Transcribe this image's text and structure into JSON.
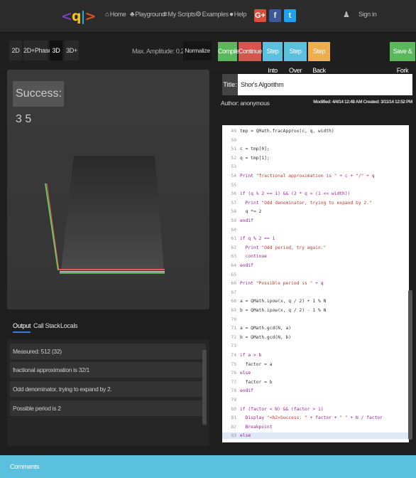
{
  "navbar": {
    "logo": {
      "left": "<",
      "q": "q",
      "bar": "|",
      "right": ">"
    },
    "items": [
      {
        "label": "Home",
        "icon": "home-icon",
        "glyph": "⌂"
      },
      {
        "label": "Playground",
        "icon": "flask-icon",
        "glyph": "♣"
      },
      {
        "label": "My Scripts",
        "icon": "list-icon",
        "glyph": "≡"
      },
      {
        "label": "Examples",
        "icon": "gear-icon",
        "glyph": "⚙",
        "caret": "▾"
      },
      {
        "label": "Help",
        "icon": "help-icon",
        "glyph": "●"
      }
    ],
    "social": [
      {
        "label": "G+",
        "icon": "google-plus-icon",
        "color": "#dd4b39"
      },
      {
        "label": "f",
        "icon": "facebook-icon",
        "color": "#3b5998"
      },
      {
        "label": "t",
        "icon": "twitter-icon",
        "color": "#1da1f2"
      }
    ],
    "user_icon": "user-icon",
    "user_glyph": "♟",
    "sign_in": "Sign in"
  },
  "view_toolbar": {
    "modes": [
      "2D",
      "2D+Phase",
      "3D",
      "3D+"
    ],
    "active_mode": "3D",
    "max_amplitude": "Max. Amplitude: 0.250000",
    "normalize": "Normalize"
  },
  "visualization": {
    "success_text": "Success: 3 5",
    "type": "3d-amplitude-surface"
  },
  "output_tabs": [
    "Output",
    "Call Stack",
    "Locals"
  ],
  "output_lines": [
    "Measured: 512 (32)",
    "fractional approximation is 32/1",
    "Odd denominator, trying to expand by 2.",
    "Possible period is 2"
  ],
  "editor_toolbar": {
    "buttons": [
      {
        "label": "Compile",
        "color": "#5cb85c"
      },
      {
        "label": "Continue",
        "color": "#d9534f"
      },
      {
        "label": "Step Into",
        "color": "#5bc0de"
      },
      {
        "label": "Step Over",
        "color": "#5bc0de"
      },
      {
        "label": "Step Back",
        "color": "#f0ad4e"
      },
      {
        "label": "Save & Fork",
        "color": "#5cb85c"
      }
    ]
  },
  "script": {
    "title_label": "Title:",
    "title_value": "Shor's Algorithm",
    "author": "Author: anonymous",
    "dates": "Modified: 4/4/14 12:48 AM   Created: 3/11/14 12:52 PM"
  },
  "code": [
    {
      "n": "49",
      "t": "tmp = QMath.fracApprox(c, q, width)",
      "k": "id"
    },
    {
      "n": "50",
      "t": "",
      "k": "id"
    },
    {
      "n": "51",
      "t": "c = tmp[0];",
      "k": "id"
    },
    {
      "n": "52",
      "t": "q = tmp[1];",
      "k": "id"
    },
    {
      "n": "53",
      "t": "",
      "k": "id"
    },
    {
      "n": "54",
      "t": "Print \"fractional approximation is \" + c + \"/\" + q",
      "k": "mix"
    },
    {
      "n": "55",
      "t": "",
      "k": "id"
    },
    {
      "n": "56",
      "t": "if (q % 2 == 1) && (2 * q < (1 << width))",
      "k": "kw"
    },
    {
      "n": "57",
      "t": "  Print \"Odd denominator, trying to expand by 2.\"",
      "k": "mix"
    },
    {
      "n": "58",
      "t": "  q *= 2",
      "k": "id"
    },
    {
      "n": "59",
      "t": "endif",
      "k": "kw"
    },
    {
      "n": "60",
      "t": "",
      "k": "id"
    },
    {
      "n": "61",
      "t": "if q % 2 == 1",
      "k": "kw"
    },
    {
      "n": "62",
      "t": "  Print \"Odd period, try again.\"",
      "k": "mix"
    },
    {
      "n": "63",
      "t": "  continue",
      "k": "kw"
    },
    {
      "n": "64",
      "t": "endif",
      "k": "kw"
    },
    {
      "n": "65",
      "t": "",
      "k": "id"
    },
    {
      "n": "66",
      "t": "Print \"Possible period is \" + q",
      "k": "mix"
    },
    {
      "n": "67",
      "t": "",
      "k": "id"
    },
    {
      "n": "68",
      "t": "a = QMath.ipow(x, q / 2) + 1 % N",
      "k": "id"
    },
    {
      "n": "69",
      "t": "b = QMath.ipow(x, q / 2) - 1 % N",
      "k": "id"
    },
    {
      "n": "70",
      "t": "",
      "k": "id"
    },
    {
      "n": "71",
      "t": "a = QMath.gcd(N, a)",
      "k": "id"
    },
    {
      "n": "72",
      "t": "b = QMath.gcd(N, b)",
      "k": "id"
    },
    {
      "n": "73",
      "t": "",
      "k": "id"
    },
    {
      "n": "74",
      "t": "if a > b",
      "k": "kw"
    },
    {
      "n": "75",
      "t": "  factor = a",
      "k": "id"
    },
    {
      "n": "76",
      "t": "else",
      "k": "kw"
    },
    {
      "n": "77",
      "t": "  factor = b",
      "k": "id"
    },
    {
      "n": "78",
      "t": "endif",
      "k": "kw"
    },
    {
      "n": "79",
      "t": "",
      "k": "id"
    },
    {
      "n": "80",
      "t": "if (factor < N) && (factor > 1)",
      "k": "kw"
    },
    {
      "n": "81",
      "t": "  Display \"<h2>Success: \" + factor + \" \" + N / factor",
      "k": "mix"
    },
    {
      "n": "82",
      "t": "  Breakpoint",
      "k": "kw"
    },
    {
      "n": "83",
      "t": "else",
      "k": "kw",
      "current": true
    }
  ],
  "comments_label": "Comments"
}
